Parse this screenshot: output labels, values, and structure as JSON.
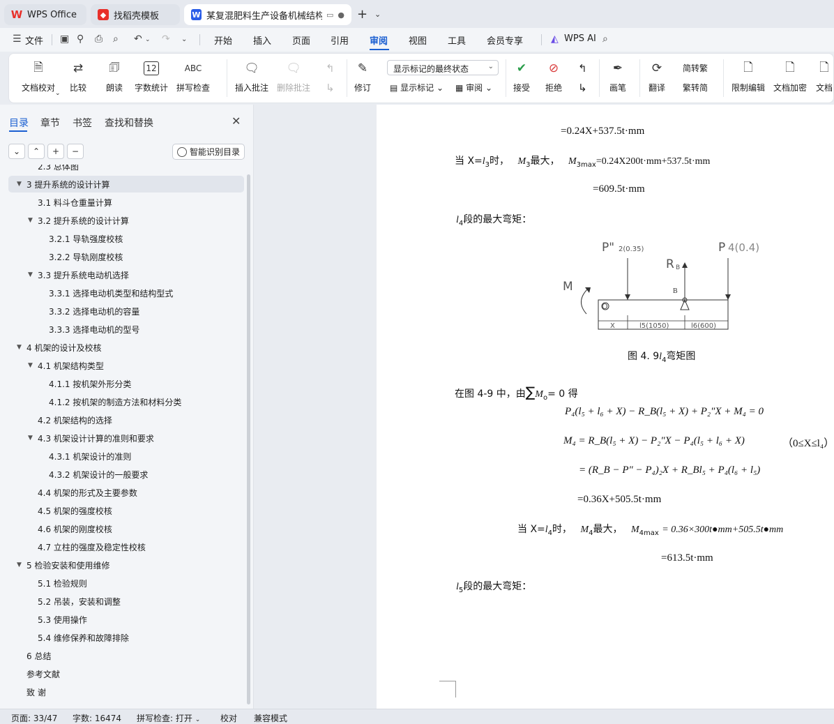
{
  "tabs": {
    "wps": "WPS Office",
    "template": "找稻壳模板",
    "doc": "某复混肥料生产设备机械结构设计"
  },
  "menu": {
    "file": "文件",
    "items": [
      "开始",
      "插入",
      "页面",
      "引用",
      "审阅",
      "视图",
      "工具",
      "会员专享"
    ],
    "wps_ai": "WPS AI"
  },
  "ribbon": {
    "doc_check": "文档校对",
    "compare": "比较",
    "read_aloud": "朗读",
    "word_count": "字数统计",
    "spell_check": "拼写检查",
    "abc": "ABC",
    "count_num": "12",
    "insert_comment": "插入批注",
    "delete_comment": "删除批注",
    "revise": "修订",
    "markup_mode": "显示标记的最终状态",
    "show_markup": "显示标记",
    "review": "审阅",
    "accept": "接受",
    "reject": "拒绝",
    "pen": "画笔",
    "translate": "翻译",
    "to_trad": "简转繁",
    "to_simp": "繁转简",
    "restrict_edit": "限制编辑",
    "encrypt": "文档加密",
    "doc_more": "文档"
  },
  "sidebar": {
    "tabs": [
      "目录",
      "章节",
      "书签",
      "查找和替换"
    ],
    "smart_toc": "智能识别目录",
    "toc": [
      {
        "text": "2.3  总体图",
        "level": 2,
        "caret": ""
      },
      {
        "text": "3  提升系统的设计计算",
        "level": 1,
        "caret": "▼",
        "active": true
      },
      {
        "text": "3.1  料斗仓重量计算",
        "level": 2,
        "caret": ""
      },
      {
        "text": "3.2  提升系统的设计计算",
        "level": 2,
        "caret": "▼"
      },
      {
        "text": "3.2.1  导轨强度校核",
        "level": 3,
        "caret": ""
      },
      {
        "text": "3.2.2  导轨刚度校核",
        "level": 3,
        "caret": ""
      },
      {
        "text": "3.3  提升系统电动机选择",
        "level": 2,
        "caret": "▼"
      },
      {
        "text": "3.3.1    选择电动机类型和结构型式",
        "level": 3,
        "caret": ""
      },
      {
        "text": "3.3.2  选择电动机的容量",
        "level": 3,
        "caret": ""
      },
      {
        "text": "3.3.3 选择电动机的型号",
        "level": 3,
        "caret": ""
      },
      {
        "text": "4  机架的设计及校核",
        "level": 1,
        "caret": "▼"
      },
      {
        "text": "4.1 机架结构类型",
        "level": 2,
        "caret": "▼"
      },
      {
        "text": "4.1.1  按机架外形分类",
        "level": 3,
        "caret": ""
      },
      {
        "text": "4.1.2  按机架的制造方法和材料分类",
        "level": 3,
        "caret": ""
      },
      {
        "text": "4.2  机架结构的选择",
        "level": 2,
        "caret": ""
      },
      {
        "text": "4.3  机架设计计算的准则和要求",
        "level": 2,
        "caret": "▼"
      },
      {
        "text": "4.3.1 机架设计的准则",
        "level": 3,
        "caret": ""
      },
      {
        "text": "4.3.2  机架设计的一般要求",
        "level": 3,
        "caret": ""
      },
      {
        "text": "4.4  机架的形式及主要参数",
        "level": 2,
        "caret": ""
      },
      {
        "text": "4.5 机架的强度校核",
        "level": 2,
        "caret": ""
      },
      {
        "text": "4.6 机架的刚度校核",
        "level": 2,
        "caret": ""
      },
      {
        "text": "4.7 立柱的强度及稳定性校核",
        "level": 2,
        "caret": ""
      },
      {
        "text": "5  检验安装和使用维修",
        "level": 1,
        "caret": "▼"
      },
      {
        "text": "5.1 检验规则",
        "level": 2,
        "caret": ""
      },
      {
        "text": "5.2 吊装，安装和调整",
        "level": 2,
        "caret": ""
      },
      {
        "text": "5.3 使用操作",
        "level": 2,
        "caret": ""
      },
      {
        "text": "5.4 维修保养和故障排除",
        "level": 2,
        "caret": ""
      },
      {
        "text": "6  总结",
        "level": 1,
        "caret": ""
      },
      {
        "text": "参考文献",
        "level": 1,
        "caret": ""
      },
      {
        "text": "致    谢",
        "level": 1,
        "caret": ""
      }
    ]
  },
  "doc": {
    "line_eq1": "=0.24X+537.5t·mm",
    "line_when3_a": "当 X=",
    "line_when3_b": "时，",
    "line_when3_c": "最大，",
    "line_when3_eq": "=0.24X200t·mm+537.5t·mm",
    "line_eq2": "=609.5t·mm",
    "l4_title": "段的最大弯矩：",
    "figure": {
      "p2": "P\"",
      "p2sub": "2(0.35)",
      "p4": "P",
      "p4sub": "4(0.4)",
      "rb": "R",
      "rbsub": "B",
      "b": "B",
      "m": "M",
      "o": "O",
      "x": "X",
      "l5": "l5(1050)",
      "l6": "l6(600)"
    },
    "caption_a": "图 4. 9",
    "caption_b": "弯矩图",
    "in_fig": "在图 4-9 中，由",
    "in_fig_end": "= 0 得",
    "eq_sum": "P₄(l₅ + l₆ + X) − R_B(l₅ + X) + P₂″X + M₄ = 0",
    "eq_m4": "M₄ = R_B(l₅ + X) − P₂″X − P₄(l₅ + l₆ + X)",
    "range": "（0≤X≤l₄）",
    "eq_expand": "= (R_B − P″ − P₄)₂X + R_Bl₅ + P₄(l₆ + l₅)",
    "eq_lin": "=0.36X+505.5t·mm",
    "when4_a": "当 X=",
    "when4_b": "时，",
    "when4_c": "最大，",
    "when4_eq": "= 0.36×300t●mm+505.5t●mm",
    "eq_final": "=613.5t·mm",
    "l5_title": "段的最大弯矩："
  },
  "status": {
    "page": "页面: 33/47",
    "words": "字数: 16474",
    "spell": "拼写检查: 打开",
    "proof": "校对",
    "compat": "兼容模式"
  }
}
